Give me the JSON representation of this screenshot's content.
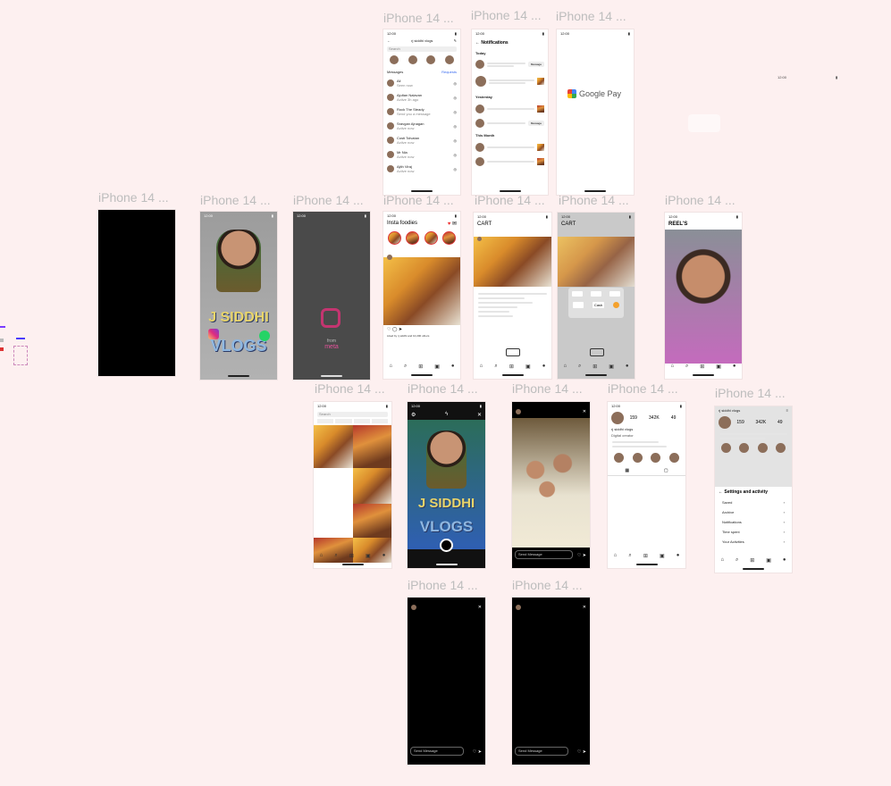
{
  "frame_label": "iPhone 14 ...",
  "status_time": "12:00",
  "top_frames": {
    "messages": {
      "username": "rj siddhi vlogs",
      "search_placeholder": "Search",
      "section": "Messages",
      "requests": "Requests",
      "rows": [
        {
          "name": "Ali",
          "sub": "Seen now"
        },
        {
          "name": "Ajultan Nalavan",
          "sub": "Active 3h ago"
        },
        {
          "name": "Rock The Steady",
          "sub": "Send you a message"
        },
        {
          "name": "Sravgan Ajnagan",
          "sub": "Active now"
        },
        {
          "name": "Costi Tolvatan",
          "sub": "Active now"
        },
        {
          "name": "Mr Nia",
          "sub": "Active now"
        },
        {
          "name": "Ajith Viraj",
          "sub": "Active now"
        }
      ]
    },
    "notifications": {
      "title": "Notifications",
      "today": "Today",
      "yesterday": "Yesterday",
      "this_month": "This Month",
      "message_label": "Message"
    },
    "gpay": {
      "text": "Google Pay"
    }
  },
  "splash_frames": {
    "brand_line1": "J SIDDHI",
    "brand_line2": "VLOGS",
    "from": "from",
    "meta": "meta"
  },
  "feed": {
    "title": "Insta foodies",
    "likes": "Liked by rj siddhi and 10,200 others"
  },
  "cart": {
    "title": "CART",
    "cash": "Cash"
  },
  "reels": {
    "title": "REEL'S"
  },
  "search": {
    "placeholder": "Search"
  },
  "camera": {
    "line1": "J SIDDHI",
    "line2": "VLOGS"
  },
  "story": {
    "send_message": "Send Message"
  },
  "profile": {
    "name": "rj siddhi vlogs",
    "posts": "159",
    "followers": "342K",
    "following": "49",
    "bio": "Digital creator"
  },
  "settings": {
    "title": "Settings and activity",
    "items": [
      "Saved",
      "Archive",
      "Notifications",
      "Time spent",
      "Your Activities"
    ]
  }
}
